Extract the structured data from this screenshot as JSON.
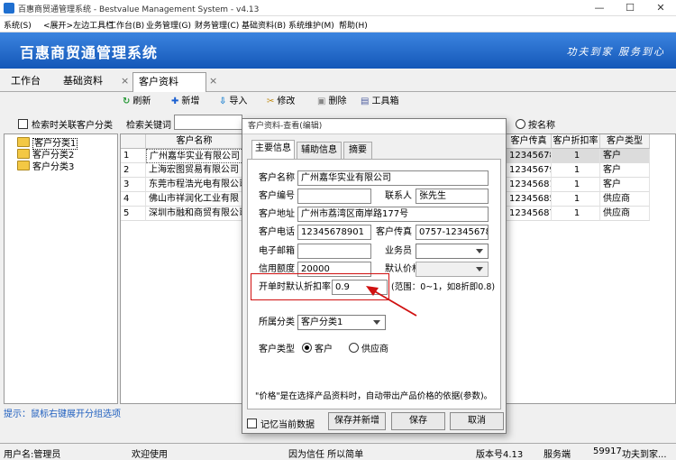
{
  "window": {
    "title": "百惠商贸通管理系统 - Bestvalue Management System  - v4.13",
    "minimize": "—",
    "maximize": "☐",
    "close": "✕"
  },
  "menu": [
    "系统(S)",
    "<展开>左边工具栏",
    "工作台(B)",
    "业务管理(G)",
    "财务管理(C)",
    "基础资料(B)",
    "系统维护(M)",
    "帮助(H)"
  ],
  "banner": {
    "title": "百惠商贸通管理系统",
    "slogan": "功夫到家 服务到心"
  },
  "nav_tabs": [
    {
      "label": "工作台"
    },
    {
      "label": "基础资料"
    },
    {
      "label": "客户资料",
      "close": "×"
    }
  ],
  "nav_close_2": "×",
  "toolbar": [
    "刷新",
    "新增",
    "导入",
    "修改",
    "删除",
    "工具箱"
  ],
  "toolbar_icons": [
    "↻",
    "✚",
    "⇩",
    "✂",
    "▣",
    "▤"
  ],
  "left_option": "检索时关联客户分类",
  "search_label": "检索关键词",
  "search_option_last": "按名称",
  "tree": [
    "客户分类1",
    "客户分类2",
    "客户分类3"
  ],
  "grid": {
    "columns": [
      "",
      "客户名称",
      "客户传真",
      "客户折扣率",
      "客户类型"
    ],
    "rows": [
      {
        "no": "1",
        "name": "广州嘉华实业有限公司",
        "fax": "12345678",
        "rate": "1",
        "type": "客户"
      },
      {
        "no": "2",
        "name": "上海宏图贸易有限公司",
        "fax": "12345679",
        "rate": "1",
        "type": "客户"
      },
      {
        "no": "3",
        "name": "东莞市程浩光电有限公司",
        "fax": "12345681",
        "rate": "1",
        "type": "客户"
      },
      {
        "no": "4",
        "name": "佛山市祥润化工业有限",
        "fax": "12345685",
        "rate": "1",
        "type": "供应商"
      },
      {
        "no": "5",
        "name": "深圳市融和商贸有限公司",
        "fax": "12345687",
        "rate": "1",
        "type": "供应商"
      }
    ]
  },
  "hint": "提示：鼠标右键展开分组选项",
  "status": {
    "user": "用户名:管理员",
    "welcome": "欢迎使用",
    "motto": "因为信任 所以简单",
    "version": "版本号4.13",
    "service": "服务端",
    "port": "59917",
    "slogan": "功夫到家..."
  },
  "dialog": {
    "title": "客户资料-查看(编辑)",
    "tabs": [
      "主要信息",
      "辅助信息",
      "摘要"
    ],
    "fields": {
      "name_label": "客户名称",
      "name": "广州嘉华实业有限公司",
      "code_label": "客户编号",
      "code": "",
      "contact_label": "联系人",
      "contact": "张先生",
      "address_label": "客户地址",
      "address": "广州市荔湾区南岸路177号",
      "phone_label": "客户电话",
      "phone": "12345678901",
      "fax_label": "客户传真",
      "fax": "0757-12345678",
      "email_label": "电子邮箱",
      "email": "",
      "salesman_label": "业务员",
      "salesman": "",
      "credit_label": "信用额度",
      "credit": "20000",
      "price_label": "默认价格",
      "price": "",
      "discount_label": "开单时默认折扣率",
      "discount": "0.9",
      "discount_hint": "(范围：0~1，如8折即0.8)",
      "category_label": "所属分类",
      "category": "客户分类1",
      "type_label": "客户类型",
      "type_options": [
        "客户",
        "供应商"
      ],
      "type_selected": "客户"
    },
    "note": "\"价格\"是在选择产品资料时，自动带出产品价格的依据(参数)。",
    "remember": "记忆当前数据",
    "buttons": {
      "save_new": "保存并新增",
      "save": "保存",
      "cancel": "取消"
    }
  },
  "colors": {
    "banner_top": "#3b84e0",
    "banner_bottom": "#1457b8",
    "highlight": "#d01010"
  }
}
